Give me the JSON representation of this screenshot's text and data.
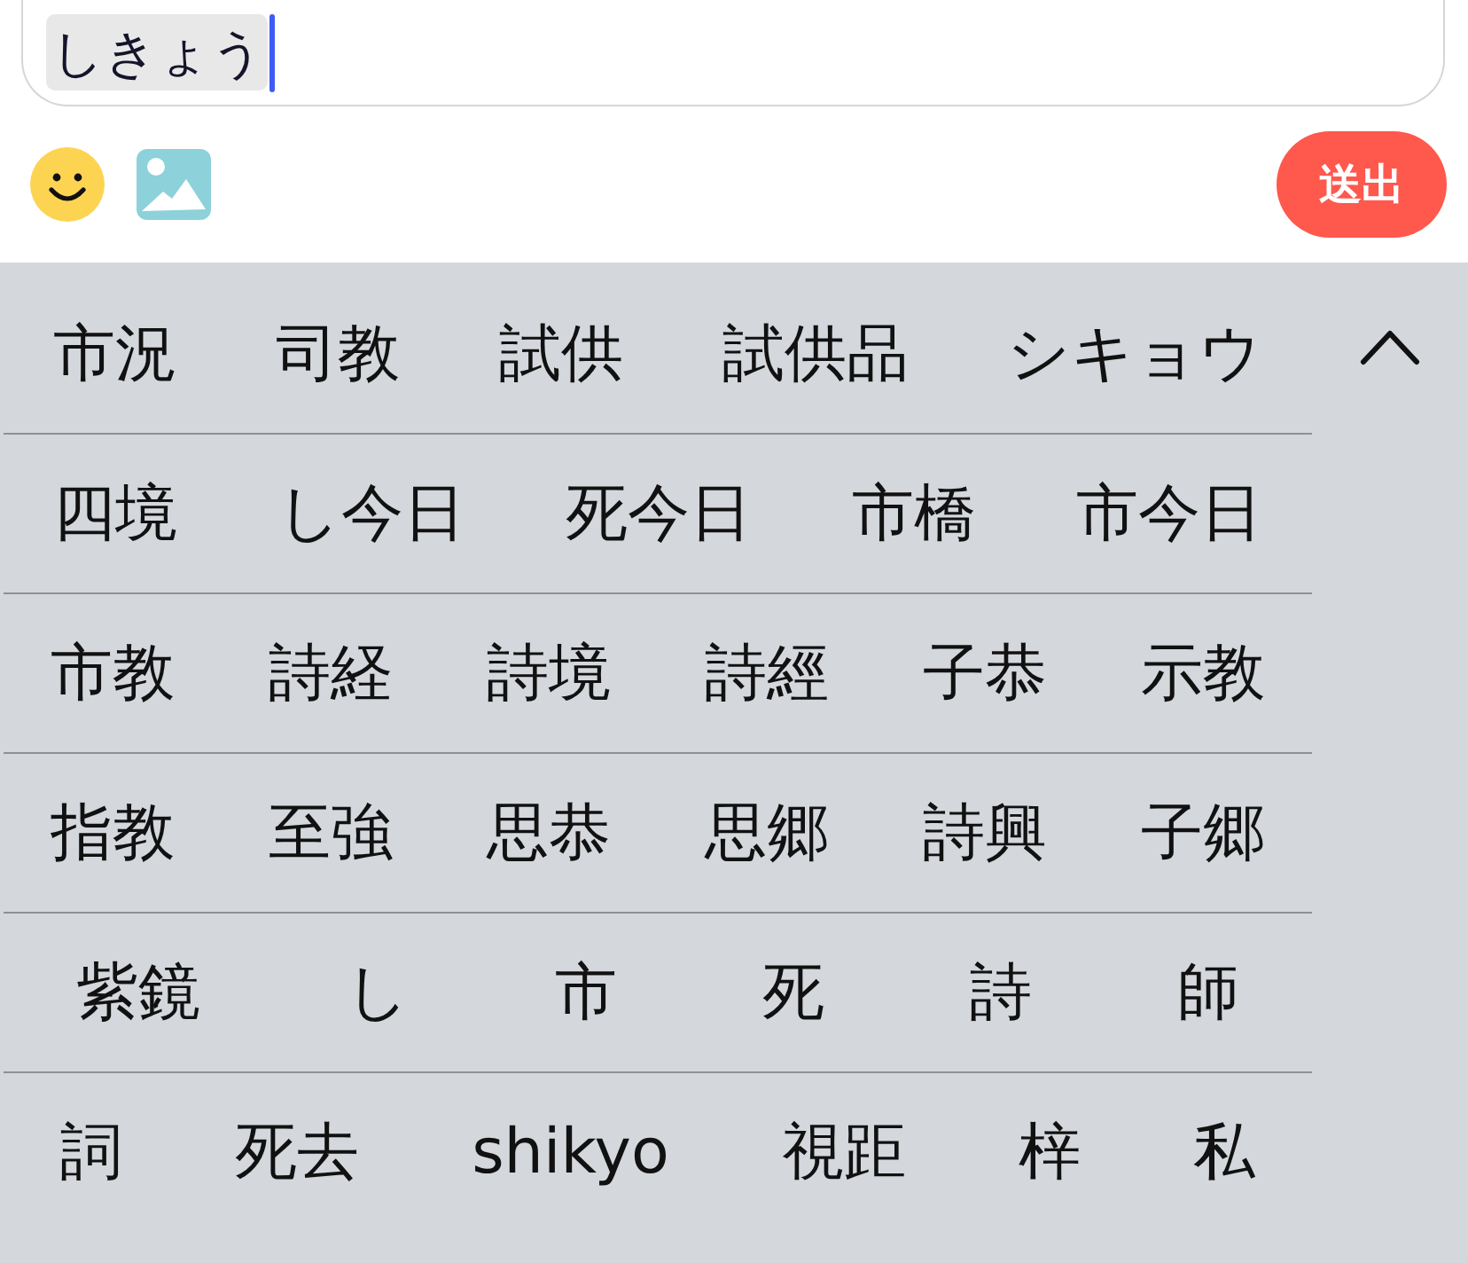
{
  "input": {
    "value": "しきょう",
    "composing": true
  },
  "toolbar": {
    "send_button": "送出"
  },
  "candidate_rows": [
    [
      "市況",
      "司教",
      "試供",
      "試供品",
      "シキョウ"
    ],
    [
      "四境",
      "し今日",
      "死今日",
      "市橋",
      "市今日"
    ],
    [
      "市教",
      "詩経",
      "詩境",
      "詩經",
      "子恭",
      "示教"
    ],
    [
      "指教",
      "至強",
      "思恭",
      "思郷",
      "詩興",
      "子郷"
    ],
    [
      "紫鏡",
      "し",
      "市",
      "死",
      "詩",
      "師"
    ],
    [
      "詞",
      "死去",
      "shikyo",
      "視距",
      "梓",
      "私"
    ]
  ]
}
